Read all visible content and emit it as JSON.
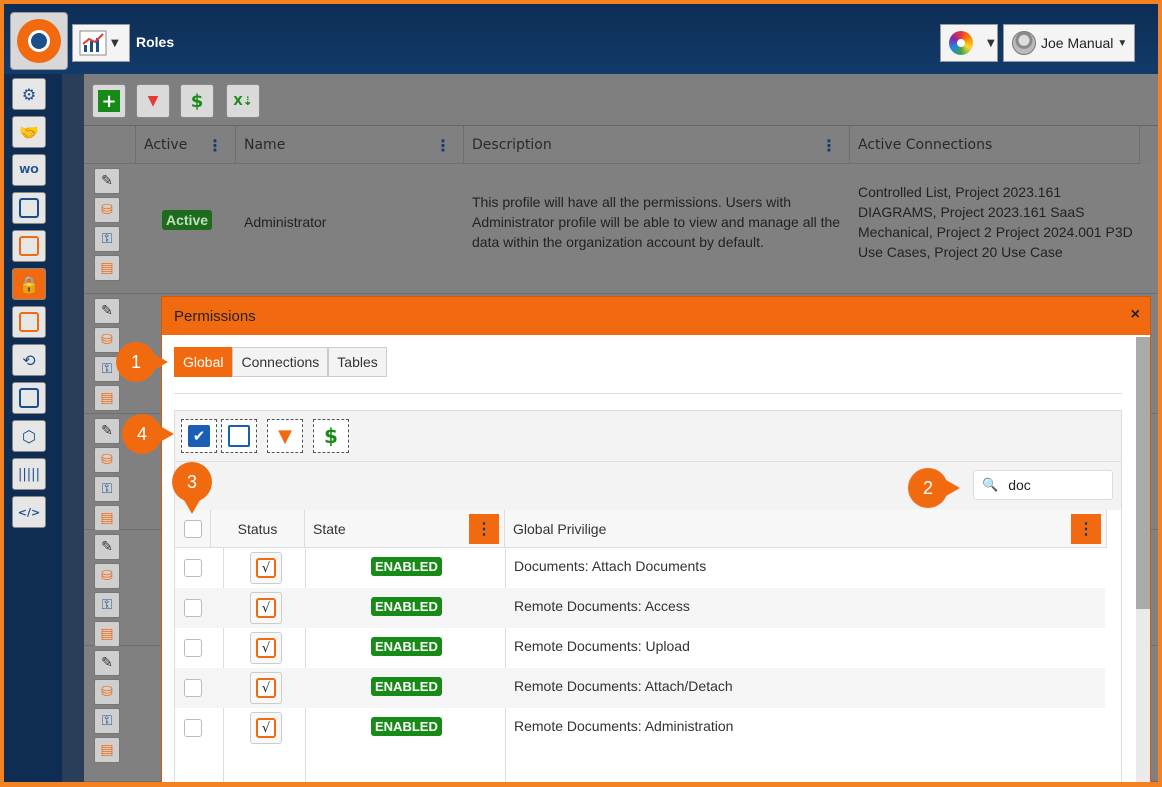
{
  "header": {
    "page_title": "Roles",
    "user_name": "Joe Manual"
  },
  "toolbar": {
    "icons": [
      "add-icon",
      "clear-filter-icon",
      "refresh-icon",
      "export-excel-icon"
    ]
  },
  "roles_grid": {
    "columns": [
      "Active",
      "Name",
      "Description",
      "Active Connections"
    ],
    "rows": [
      {
        "active": "Active",
        "name": "Administrator",
        "description": "This profile will have all the permissions. Users with Administrator profile will be able to view and manage all the data within the organization account by default.",
        "connections": "Controlled List, Project 2023.161 DIAGRAMS, Project 2023.161 SaaS Mechanical, Project 2 Project 2024.001 P3D Use Cases, Project 20 Use Case"
      }
    ]
  },
  "modal": {
    "title": "Permissions",
    "close": "×",
    "tabs": [
      "Global",
      "Connections",
      "Tables"
    ],
    "selected_tab": "Global",
    "search": {
      "value": "doc"
    },
    "columns": {
      "status": "Status",
      "state": "State",
      "privilege": "Global Privilige"
    },
    "rows": [
      {
        "status": "√",
        "state": "ENABLED",
        "privilege": "Documents: Attach Documents"
      },
      {
        "status": "√",
        "state": "ENABLED",
        "privilege": "Remote Documents: Access"
      },
      {
        "status": "√",
        "state": "ENABLED",
        "privilege": "Remote Documents: Upload"
      },
      {
        "status": "√",
        "state": "ENABLED",
        "privilege": "Remote Documents: Attach/Detach"
      },
      {
        "status": "√",
        "state": "ENABLED",
        "privilege": "Remote Documents: Administration"
      }
    ]
  },
  "callouts": [
    "1",
    "2",
    "3",
    "4"
  ],
  "colors": {
    "accent": "#f26a10",
    "header_bg": "#0d2e55",
    "enabled": "#178a17",
    "active_badge": "#1e6b1e"
  }
}
